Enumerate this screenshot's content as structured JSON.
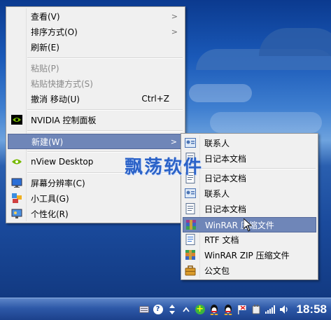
{
  "desktop": {
    "accent": "#6f86b8"
  },
  "context_menu": {
    "items": [
      {
        "label": "查看(V)",
        "submenu": true
      },
      {
        "label": "排序方式(O)",
        "submenu": true
      },
      {
        "label": "刷新(E)"
      },
      {
        "label": "粘贴(P)",
        "disabled": true
      },
      {
        "label": "粘贴快捷方式(S)",
        "disabled": true
      },
      {
        "label": "撤消 移动(U)",
        "shortcut": "Ctrl+Z"
      },
      {
        "label": "NVIDIA 控制面板",
        "icon": "nvidia-icon"
      },
      {
        "label": "新建(W)",
        "submenu": true,
        "selected": true
      },
      {
        "label": "nView Desktop",
        "icon": "nview-icon",
        "submenu": true
      },
      {
        "label": "屏幕分辨率(C)",
        "icon": "monitor-icon"
      },
      {
        "label": "小工具(G)",
        "icon": "gadgets-icon"
      },
      {
        "label": "个性化(R)",
        "icon": "personalize-icon"
      }
    ],
    "submenu_arrow": ">"
  },
  "new_submenu": {
    "items": [
      {
        "label": "联系人",
        "icon": "contact-icon"
      },
      {
        "label": "日记本文档",
        "icon": "journal-icon"
      },
      {
        "label": "日记本文档",
        "icon": "journal-icon"
      },
      {
        "label": "联系人",
        "icon": "contact-icon"
      },
      {
        "label": "日记本文档",
        "icon": "journal-icon"
      },
      {
        "label": "WinRAR 压缩文件",
        "icon": "winrar-icon",
        "selected": true
      },
      {
        "label": "RTF 文档",
        "icon": "rtf-doc-icon"
      },
      {
        "label": "WinRAR ZIP 压缩文件",
        "icon": "winrar-zip-icon"
      },
      {
        "label": "公文包",
        "icon": "briefcase-icon"
      }
    ]
  },
  "watermark": "飘荡软件",
  "taskbar": {
    "clock": "18:58",
    "tray_icons": [
      "keyboard-icon",
      "help-icon",
      "network-updown-icon",
      "show-hidden-icon",
      "add-icon",
      "qq-icon",
      "qq-icon",
      "flag-icon",
      "device-icon",
      "signal-icon",
      "volume-icon"
    ]
  }
}
